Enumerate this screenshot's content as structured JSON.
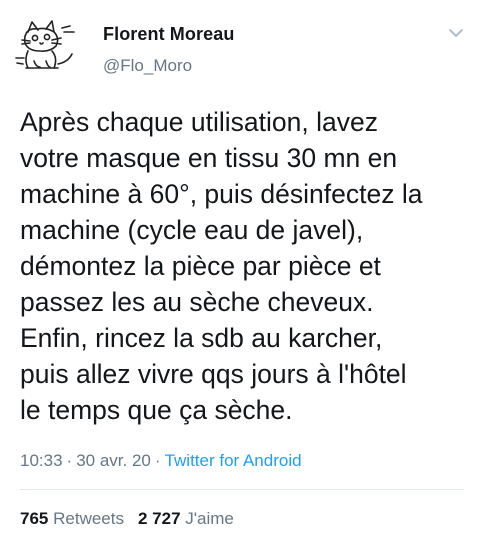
{
  "author": {
    "display_name": "Florent Moreau",
    "handle": "@Flo_Moro",
    "avatar_icon": "cat-sketch-avatar"
  },
  "tweet": {
    "lines": [
      "Après chaque utilisation, lavez",
      "votre masque en tissu 30 mn en",
      "machine à 60°, puis désinfectez la",
      "machine (cycle eau de javel),",
      "démontez la pièce par pièce et",
      "passez les au sèche cheveux.",
      "Enfin, rincez la sdb au karcher,",
      "puis allez vivre qqs jours à l'hôtel",
      "le temps que ça sèche."
    ]
  },
  "meta": {
    "time": "10:33",
    "separator": "·",
    "date": "30 avr. 20",
    "source": "Twitter for Android"
  },
  "stats": {
    "retweets_count": "765",
    "retweets_label": "Retweets",
    "likes_count": "2 727",
    "likes_label": "J'aime"
  },
  "colors": {
    "text": "#14171a",
    "secondary": "#657786",
    "link": "#1da1f2",
    "divider": "#e1e8ed"
  }
}
